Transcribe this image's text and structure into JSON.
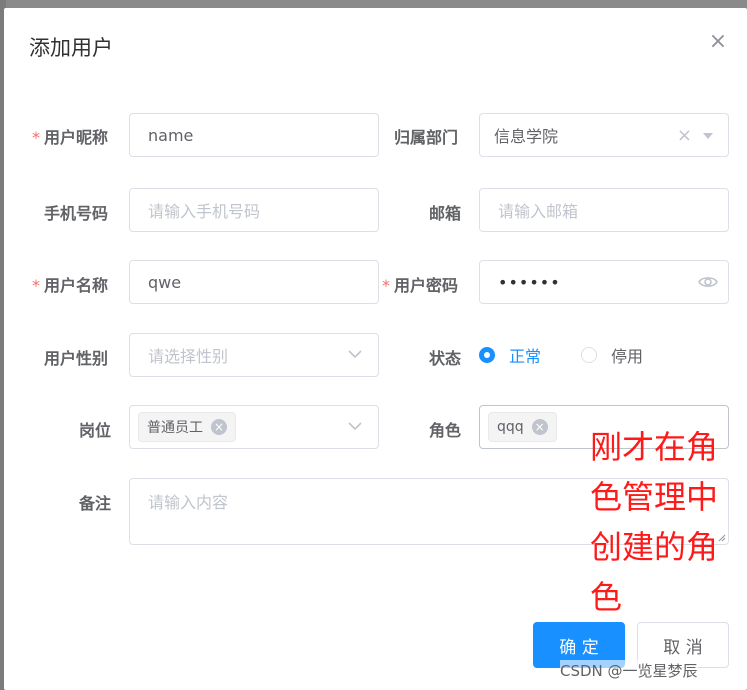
{
  "dialog": {
    "title": "添加用户",
    "close_glyph": "×"
  },
  "fields": {
    "nickname": {
      "label": "用户昵称",
      "required": "*",
      "value": "name"
    },
    "dept": {
      "label": "归属部门",
      "value": "信息学院",
      "clear_glyph": "×"
    },
    "phone": {
      "label": "手机号码",
      "placeholder": "请输入手机号码"
    },
    "email": {
      "label": "邮箱",
      "placeholder": "请输入邮箱"
    },
    "username": {
      "label": "用户名称",
      "required": "*",
      "value": "qwe"
    },
    "password": {
      "label": "用户密码",
      "required": "*",
      "value": "••••••"
    },
    "gender": {
      "label": "用户性别",
      "placeholder": "请选择性别"
    },
    "status": {
      "label": "状态",
      "options": [
        "正常",
        "停用"
      ],
      "selected": "正常"
    },
    "post": {
      "label": "岗位",
      "tags": [
        "普通员工"
      ]
    },
    "role": {
      "label": "角色",
      "tags": [
        "qqq"
      ]
    },
    "remark": {
      "label": "备注",
      "placeholder": "请输入内容"
    }
  },
  "buttons": {
    "confirm": "确 定",
    "cancel": "取 消"
  },
  "annotation": "刚才在角色管理中创建的角色",
  "watermark": "CSDN @一览星梦辰",
  "icons": {
    "close": "close-icon",
    "clear": "circle-close-icon",
    "arrow": "chevron-down-icon",
    "eye": "eye-icon",
    "tag_close": "close-icon"
  },
  "colors": {
    "primary": "#1890ff",
    "required": "#f56c6c",
    "annotation": "#ff1a1a"
  }
}
